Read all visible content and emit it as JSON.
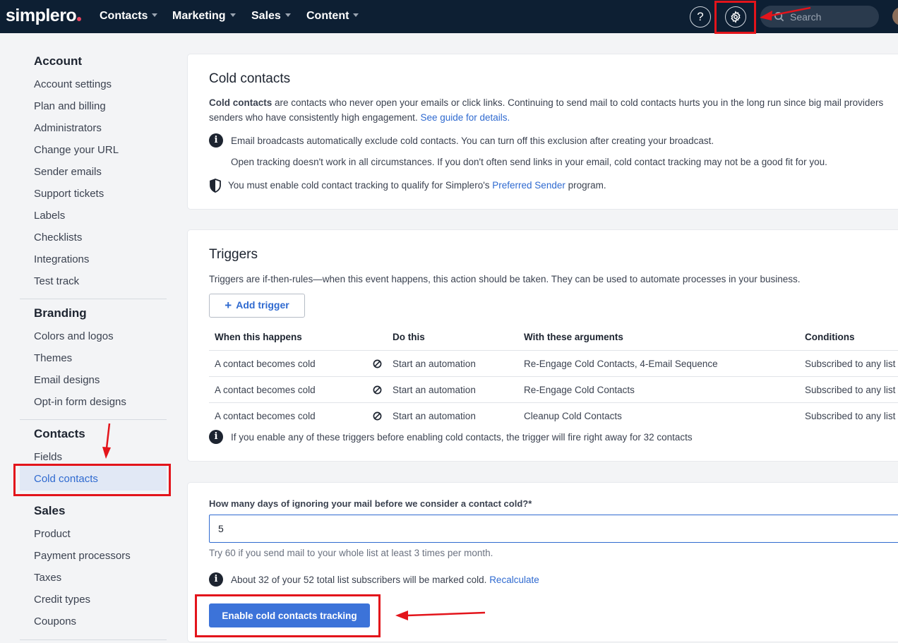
{
  "topbar": {
    "logo": "simplero",
    "nav": [
      "Contacts",
      "Marketing",
      "Sales",
      "Content"
    ],
    "help": "?",
    "search_placeholder": "Search"
  },
  "sidebar": {
    "account": {
      "heading": "Account",
      "items": [
        "Account settings",
        "Plan and billing",
        "Administrators",
        "Change your URL",
        "Sender emails",
        "Support tickets",
        "Labels",
        "Checklists",
        "Integrations",
        "Test track"
      ]
    },
    "branding": {
      "heading": "Branding",
      "items": [
        "Colors and logos",
        "Themes",
        "Email designs",
        "Opt-in form designs"
      ]
    },
    "contacts": {
      "heading": "Contacts",
      "items": [
        "Fields",
        "Cold contacts"
      ]
    },
    "sales": {
      "heading": "Sales",
      "items": [
        "Product",
        "Payment processors",
        "Taxes",
        "Credit types",
        "Coupons"
      ]
    }
  },
  "cold": {
    "title": "Cold contacts",
    "intro_bold": "Cold contacts",
    "intro_line1": " are contacts who never open your emails or click links. Continuing to send mail to cold contacts hurts you in the long run since big mail providers",
    "intro_line2": "senders who have consistently high engagement. ",
    "guide_link": "See guide for details.",
    "info1": "Email broadcasts automatically exclude cold contacts. You can turn off this exclusion after creating your broadcast.",
    "info2": "Open tracking doesn't work in all circumstances. If you don't often send links in your email, cold contact tracking may not be a good fit for you.",
    "shield_pre": "You must enable cold contact tracking to qualify for Simplero's ",
    "shield_link": "Preferred Sender",
    "shield_post": " program."
  },
  "triggers": {
    "title": "Triggers",
    "desc": "Triggers are if-then-rules—when this event happens, this action should be taken. They can be used to automate processes in your business.",
    "add_label": "Add trigger",
    "headers": [
      "When this happens",
      "Do this",
      "With these arguments",
      "Conditions"
    ],
    "rows": [
      {
        "when": "A contact becomes cold",
        "do": "Start an automation",
        "args": "Re-Engage Cold Contacts, 4-Email Sequence",
        "cond": "Subscribed to any list"
      },
      {
        "when": "A contact becomes cold",
        "do": "Start an automation",
        "args": "Re-Engage Cold Contacts",
        "cond": "Subscribed to any list"
      },
      {
        "when": "A contact becomes cold",
        "do": "Start an automation",
        "args": "Cleanup Cold Contacts",
        "cond": "Subscribed to any list"
      }
    ],
    "note": "If you enable any of these triggers before enabling cold contacts, the trigger will fire right away for 32 contacts"
  },
  "settings": {
    "question": "How many days of ignoring your mail before we consider a contact cold?*",
    "days_value": "5",
    "hint": "Try 60 if you send mail to your whole list at least 3 times per month.",
    "estimate": "About 32 of your 52 total list subscribers will be marked cold. ",
    "recalc_link": "Recalculate",
    "enable_label": "Enable cold contacts tracking"
  },
  "colors": {
    "nav_bg": "#0d1f33",
    "accent": "#2f6ad0",
    "highlight": "#e3141b"
  }
}
